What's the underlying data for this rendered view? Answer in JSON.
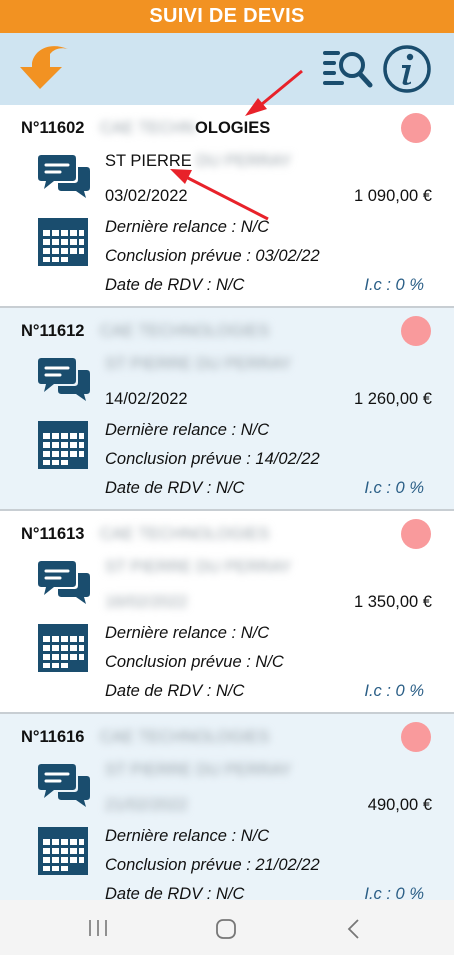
{
  "app": {
    "title": "SUIVI DE DEVIS"
  },
  "icons": {
    "back": "back-arrow-icon",
    "search": "list-search-icon",
    "info": "info-icon",
    "chat": "chat-bubbles-icon",
    "calendar": "calendar-icon"
  },
  "colors": {
    "header": "#f29222",
    "toolbar": "#cfe4f1",
    "accent": "#1a4d6e",
    "status": "#f99a9c",
    "annotation": "#e8222a"
  },
  "quotes": [
    {
      "number": "N°11602",
      "client_visible": "OLOGIES",
      "client_blurred": "CAE TECHN",
      "contact_visible": "ST PIERRE",
      "contact_blurred": "DU PERRAY",
      "date": "03/02/2022",
      "amount": "1 090,00 €",
      "relance": "Dernière relance : N/C",
      "conclusion": "Conclusion prévue : 03/02/22",
      "rdv": "Date de RDV : N/C",
      "ic": "I.c : 0 %"
    },
    {
      "number": "N°11612",
      "client_blurred": "CAE TECHNOLOGIES",
      "contact_blurred": "ST PIERRE DU PERRAY",
      "date": "14/02/2022",
      "amount": "1 260,00 €",
      "relance": "Dernière relance : N/C",
      "conclusion": "Conclusion prévue : 14/02/22",
      "rdv": "Date de RDV : N/C",
      "ic": "I.c : 0 %"
    },
    {
      "number": "N°11613",
      "client_blurred": "CAE TECHNOLOGIES",
      "contact_blurred": "ST PIERRE DU PERRAY",
      "date_blurred": "16/02/2022",
      "amount": "1 350,00 €",
      "relance": "Dernière relance : N/C",
      "conclusion": "Conclusion prévue : N/C",
      "rdv": "Date de RDV : N/C",
      "ic": "I.c : 0 %"
    },
    {
      "number": "N°11616",
      "client_blurred": "CAE TECHNOLOGIES",
      "contact_blurred": "ST PIERRE DU PERRAY",
      "date_blurred": "21/02/2022",
      "amount": "490,00 €",
      "relance": "Dernière relance : N/C",
      "conclusion": "Conclusion prévue : 21/02/22",
      "rdv": "Date de RDV : N/C",
      "ic": "I.c : 0 %"
    }
  ],
  "navbar": {
    "recent": "recent-apps-icon",
    "home": "home-icon",
    "back": "nav-back-icon"
  }
}
